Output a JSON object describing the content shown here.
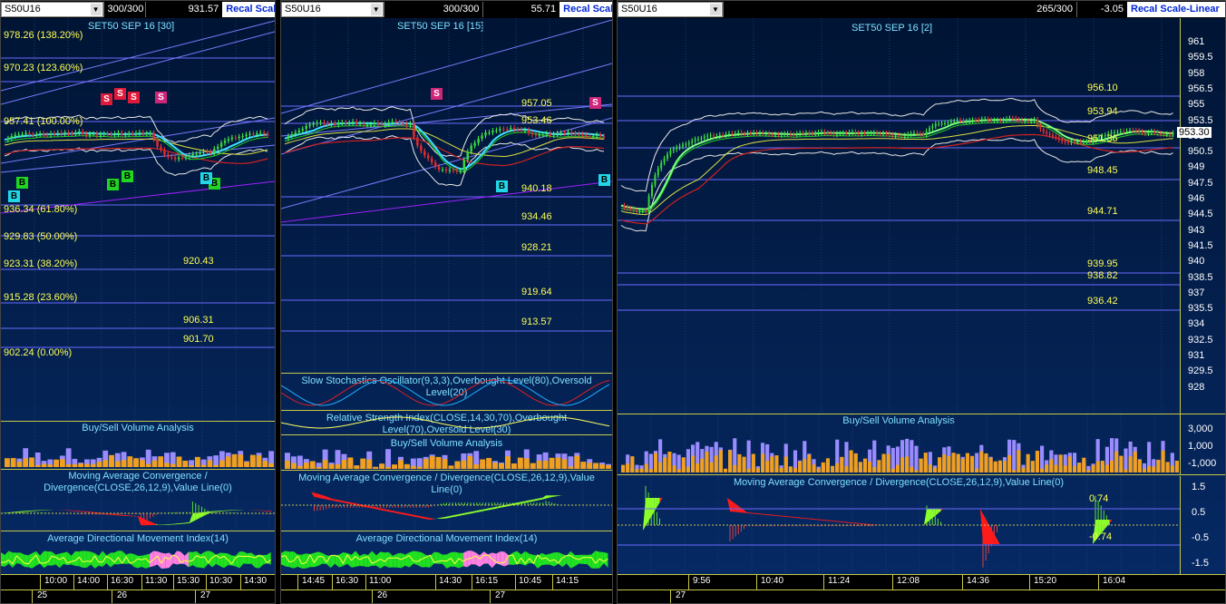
{
  "panes": [
    {
      "id": "left",
      "symbol": "S50U16",
      "bars": "300/300",
      "last": "931.57",
      "recal": "Recal Scal",
      "title": "SET50 SEP 16  [30]",
      "fib_levels": [
        "978.26 (138.20%)",
        "970.23 (123.60%)",
        "957.41 (100.00%)",
        "936.34 (61.80%)",
        "929.83 (50.00%)",
        "923.31 (38.20%)",
        "915.28 (23.60%)",
        "902.24 (0.00%)"
      ],
      "levels": [
        "920.43",
        "906.31",
        "901.70"
      ],
      "sub_volume": "Buy/Sell Volume Analysis",
      "sub_macd": "Moving Average Convergence / Divergence(CLOSE,26,12,9),Value Line(0)",
      "sub_adx": "Average Directional Movement Index(14)",
      "times": [
        "10:00",
        "14:00",
        "16:30",
        "11:30",
        "15:30",
        "10:30",
        "14:30"
      ],
      "dates": [
        "25",
        "26",
        "27"
      ],
      "signals": {
        "sell": "S",
        "buy": "B"
      }
    },
    {
      "id": "mid",
      "bars": "300/300",
      "last": "55.71",
      "recal": "Recal Scal",
      "title": "SET50 SEP 16  [15]",
      "levels": [
        "957.05",
        "953.46",
        "940.18",
        "934.46",
        "928.21",
        "919.64",
        "913.57"
      ],
      "sub_stoch": "Slow Stochastics Oscillator(9,3,3),Overbought Level(80),Oversold Level(20)",
      "sub_rsi": "Relative Strength Index(CLOSE,14,30,70),Overbought Level(70),Oversold Level(30)",
      "sub_volume": "Buy/Sell Volume Analysis",
      "sub_macd": "Moving Average Convergence / Divergence(CLOSE,26,12,9),Value Line(0)",
      "sub_adx": "Average Directional Movement Index(14)",
      "times": [
        "14:45",
        "16:30",
        "11:00",
        "14:30",
        "16:15",
        "10:45",
        "14:15"
      ],
      "dates": [
        "26",
        "27"
      ]
    },
    {
      "id": "right",
      "symbol": "S50U16",
      "bars": "265/300",
      "last": "-3.05",
      "recal": "Recal Scale-Linear",
      "title": "SET50 SEP 16  [2]",
      "levels": [
        "956.10",
        "953.94",
        "951.36",
        "948.45",
        "944.71",
        "939.95",
        "938.82",
        "936.42"
      ],
      "last_price": "953.30",
      "price_axis": [
        "961",
        "959.5",
        "958",
        "956.5",
        "955",
        "953.5",
        "952",
        "950.5",
        "949",
        "947.5",
        "946",
        "944.5",
        "943",
        "941.5",
        "940",
        "938.5",
        "937",
        "935.5",
        "934",
        "932.5",
        "931",
        "929.5",
        "928"
      ],
      "sub_volume": "Buy/Sell Volume Analysis",
      "vol_axis": [
        "3,000",
        "1,000",
        "-1,000"
      ],
      "sub_macd": "Moving Average Convergence / Divergence(CLOSE,26,12,9),Value Line(0)",
      "macd_levels": [
        "0.74",
        "-0.74"
      ],
      "macd_axis": [
        "1.5",
        "0.5",
        "-0.5",
        "-1.5"
      ],
      "times": [
        "9:56",
        "10:40",
        "11:24",
        "12:08",
        "14:36",
        "15:20",
        "16:04"
      ],
      "dates": [
        "27"
      ]
    }
  ]
}
